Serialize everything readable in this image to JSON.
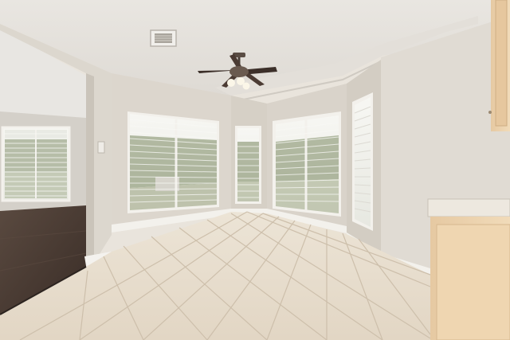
{
  "scene": {
    "description_visible_text": [],
    "palette": {
      "wall": "#ded9d0",
      "wall_shadow": "#cfc9bf",
      "ceiling": "#ebe8e3",
      "tile": "#e6dccc",
      "grout": "#cbbfae",
      "baseboard": "#f4f2ee",
      "wood_floor": "#4a3b33",
      "cabinet": "#ecd2ad",
      "window_bright": "#f3f2ee",
      "foliage": "#7c8a63"
    },
    "icons": [
      "ceiling-fan-icon",
      "air-vent-icon",
      "light-switch-icon"
    ]
  }
}
